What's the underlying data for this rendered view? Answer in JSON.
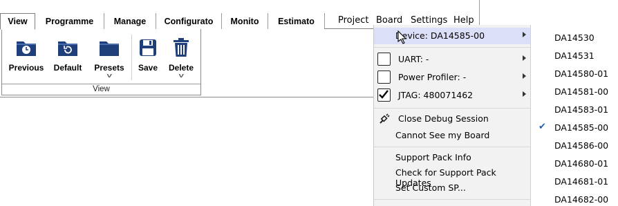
{
  "tabs": [
    {
      "label": "View",
      "active": true
    },
    {
      "label": "Programme",
      "active": false
    },
    {
      "label": "Manage",
      "active": false
    },
    {
      "label": "Configurato",
      "active": false
    },
    {
      "label": "Monito",
      "active": false
    },
    {
      "label": "Estimato",
      "active": false
    }
  ],
  "menus": {
    "project": "Project",
    "board": "Board",
    "settings": "Settings",
    "help": "Help"
  },
  "ribbon": {
    "buttons": [
      {
        "label": "Previous",
        "icon": "folder-clock-icon"
      },
      {
        "label": "Default",
        "icon": "folder-restore-icon"
      },
      {
        "label": "Presets",
        "icon": "folder-icon"
      },
      {
        "label": "Save",
        "icon": "save-icon"
      },
      {
        "label": "Delete",
        "icon": "trash-icon"
      }
    ],
    "group_label": "View"
  },
  "board_menu": {
    "device": "Device: DA14585-00",
    "uart": "UART: -",
    "power_profiler": "Power Profiler: -",
    "jtag": "JTAG: 480071462",
    "jtag_checked": true,
    "close_debug": "Close Debug Session",
    "cannot_see": "Cannot See my Board",
    "support_pack_info": "Support Pack Info",
    "check_updates": "Check for Support Pack Updates",
    "set_custom": "Set Custom SP..."
  },
  "devices": {
    "selected": "DA14585-00",
    "items": [
      "DA14530",
      "DA14531",
      "DA14580-01",
      "DA14581-00",
      "DA14583-01",
      "DA14585-00",
      "DA14586-00",
      "DA14680-01",
      "DA14681-01",
      "DA14682-00"
    ]
  },
  "colors": {
    "accent": "#1f3f7a",
    "highlight": "#dcdff8",
    "check": "#1d5fb5"
  }
}
